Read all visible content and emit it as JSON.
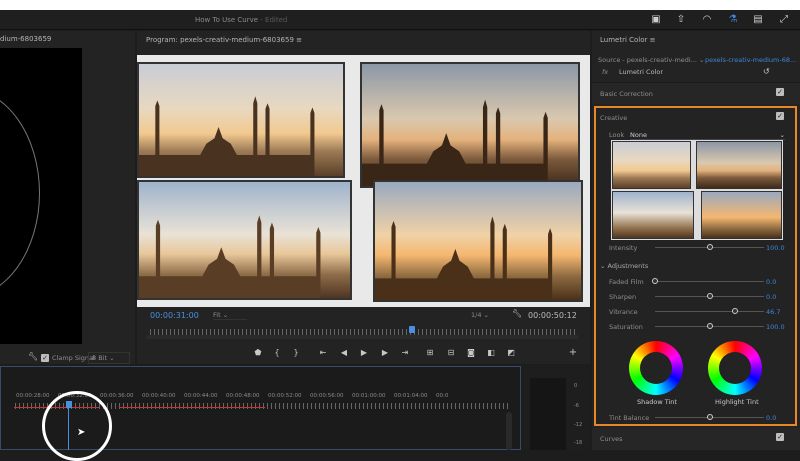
{
  "window": {
    "title": "How To Use Curve",
    "edited": " - Edited"
  },
  "source_panel": {
    "header": "dium-6803659",
    "clamp_signal": "Clamp Signal",
    "bit_depth": "8 Bit"
  },
  "program": {
    "header": "Program: pexels-creativ-medium-6803659",
    "current_time": "00:00:31:00",
    "zoom": "Fit",
    "resolution": "1/4",
    "duration": "00:00:50:12",
    "playhead_fraction": 0.6
  },
  "timeline": {
    "ticks": [
      "00:00:28:00",
      "00:00:32:00",
      "00:00:36:00",
      "00:00:40:00",
      "00:00:44:00",
      "00:00:48:00",
      "00:00:52:00",
      "00:00:56:00",
      "00:01:00:00",
      "00:01:04:00",
      "00:0"
    ]
  },
  "meter": {
    "levels": [
      "0",
      "-6",
      "-12",
      "-18"
    ]
  },
  "lumetri": {
    "title": "Lumetri Color",
    "source": "Source - pexels-creativ-medi...",
    "clip": "pexels-creativ-medium-68...",
    "fx": "fx",
    "effect": "Lumetri Color",
    "basic_correction": "Basic Correction",
    "creative": "Creative",
    "look_label": "Look",
    "look_value": "None",
    "intensity": {
      "label": "Intensity",
      "value": "100.0",
      "fraction": 0.5
    },
    "adjustments": "Adjustments",
    "sliders": [
      {
        "label": "Faded Film",
        "value": "0.0",
        "fraction": 0.0
      },
      {
        "label": "Sharpen",
        "value": "0.0",
        "fraction": 0.5
      },
      {
        "label": "Vibrance",
        "value": "46.7",
        "fraction": 0.73
      },
      {
        "label": "Saturation",
        "value": "100.0",
        "fraction": 0.5
      }
    ],
    "shadow_tint": "Shadow Tint",
    "highlight_tint": "Highlight Tint",
    "tint_balance": {
      "label": "Tint Balance",
      "value": "0.0",
      "fraction": 0.5
    },
    "curves": "Curves",
    "accent": "#e8862a"
  }
}
